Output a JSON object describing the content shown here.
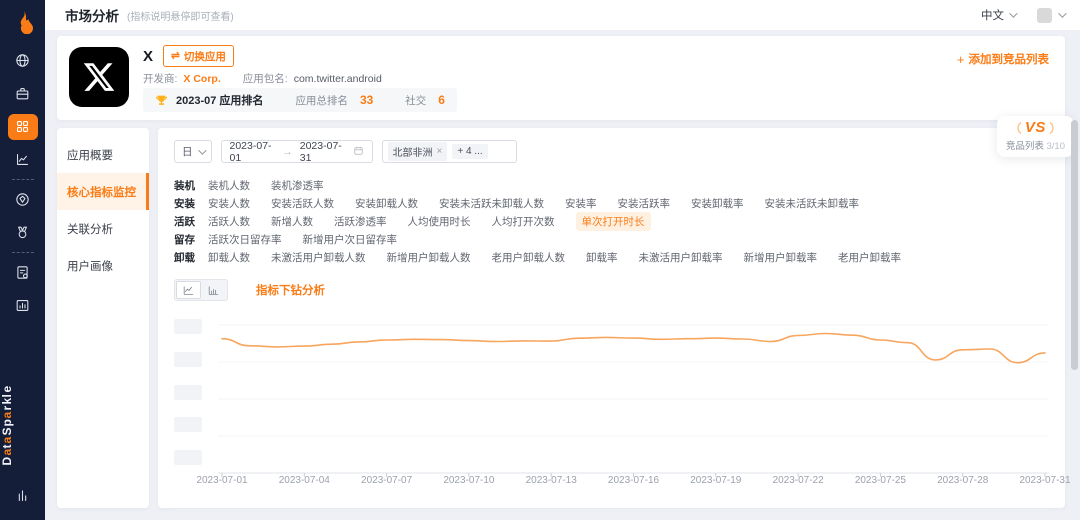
{
  "accent": "#FA7C16",
  "icons": {
    "plus": "+",
    "close": "×",
    "range_arrow": "→",
    "switch": "⇌"
  },
  "topbar": {
    "title": "市场分析",
    "hint": "(指标说明悬停即可查看)",
    "language": "中文"
  },
  "sidebar": {
    "brand": "DataSparkle"
  },
  "app_card": {
    "name": "X",
    "switch_label": "切换应用",
    "developer_label": "开发商:",
    "developer": "X Corp.",
    "package_label": "应用包名:",
    "package": "com.twitter.android",
    "rank_period": "2023-07 应用排名",
    "total_rank_label": "应用总排名",
    "total_rank": "33",
    "category_label": "社交",
    "category_rank": "6",
    "add_competitor": "添加到竞品列表"
  },
  "vs_widget": {
    "vs": "VS",
    "label": "竞品列表",
    "count": "3/10"
  },
  "menu": {
    "items": [
      {
        "label": "应用概要",
        "active": false
      },
      {
        "label": "核心指标监控",
        "active": true
      },
      {
        "label": "关联分析",
        "active": false
      },
      {
        "label": "用户画像",
        "active": false
      }
    ]
  },
  "filters": {
    "granularity": "日",
    "date_start": "2023-07-01",
    "date_end": "2023-07-31",
    "region_tag": "北部非洲",
    "region_more": "+ 4 ..."
  },
  "metrics": {
    "groups": [
      {
        "name": "装机",
        "items": [
          "装机人数",
          "装机渗透率"
        ],
        "active": ""
      },
      {
        "name": "安装",
        "items": [
          "安装人数",
          "安装活跃人数",
          "安装卸载人数",
          "安装未活跃未卸载人数",
          "安装率",
          "安装活跃率",
          "安装卸载率",
          "安装未活跃未卸载率"
        ],
        "active": ""
      },
      {
        "name": "活跃",
        "items": [
          "活跃人数",
          "新增人数",
          "活跃渗透率",
          "人均使用时长",
          "人均打开次数",
          "单次打开时长"
        ],
        "active": "单次打开时长"
      },
      {
        "name": "留存",
        "items": [
          "活跃次日留存率",
          "新增用户次日留存率"
        ],
        "active": ""
      },
      {
        "name": "卸载",
        "items": [
          "卸载人数",
          "未激活用户卸载人数",
          "新增用户卸载人数",
          "老用户卸载人数",
          "卸载率",
          "未激活用户卸载率",
          "新增用户卸载率",
          "老用户卸载率"
        ],
        "active": ""
      }
    ]
  },
  "toolbar": {
    "drill_label": "指标下钻分析"
  },
  "chart_data": {
    "type": "line",
    "title": "",
    "xlabel": "",
    "ylabel": "",
    "y_axis": {
      "labels_redacted": true,
      "range_normalized_pct": [
        0,
        100
      ]
    },
    "grid": true,
    "line_color": "#F8A55E",
    "x": [
      "2023-07-01",
      "2023-07-02",
      "2023-07-03",
      "2023-07-04",
      "2023-07-05",
      "2023-07-06",
      "2023-07-07",
      "2023-07-08",
      "2023-07-09",
      "2023-07-10",
      "2023-07-11",
      "2023-07-12",
      "2023-07-13",
      "2023-07-14",
      "2023-07-15",
      "2023-07-16",
      "2023-07-17",
      "2023-07-18",
      "2023-07-19",
      "2023-07-20",
      "2023-07-21",
      "2023-07-22",
      "2023-07-23",
      "2023-07-24",
      "2023-07-25",
      "2023-07-26",
      "2023-07-27",
      "2023-07-28",
      "2023-07-29",
      "2023-07-30",
      "2023-07-31"
    ],
    "x_tick_labels": [
      "2023-07-01",
      "2023-07-04",
      "2023-07-07",
      "2023-07-10",
      "2023-07-13",
      "2023-07-16",
      "2023-07-19",
      "2023-07-22",
      "2023-07-25",
      "2023-07-28",
      "2023-07-31"
    ],
    "series": [
      {
        "name": "单次打开时长",
        "values_normalized_pct": [
          85,
          80.5,
          79.8,
          80.3,
          81.5,
          83,
          84.2,
          84.6,
          84.4,
          83.8,
          83.2,
          83.6,
          83.5,
          85.3,
          85.8,
          85.4,
          84.6,
          85,
          85.4,
          84.8,
          83.2,
          87,
          88.3,
          87.2,
          84.2,
          82.5,
          71.5,
          78,
          78.5,
          69.8,
          76
        ]
      }
    ]
  }
}
